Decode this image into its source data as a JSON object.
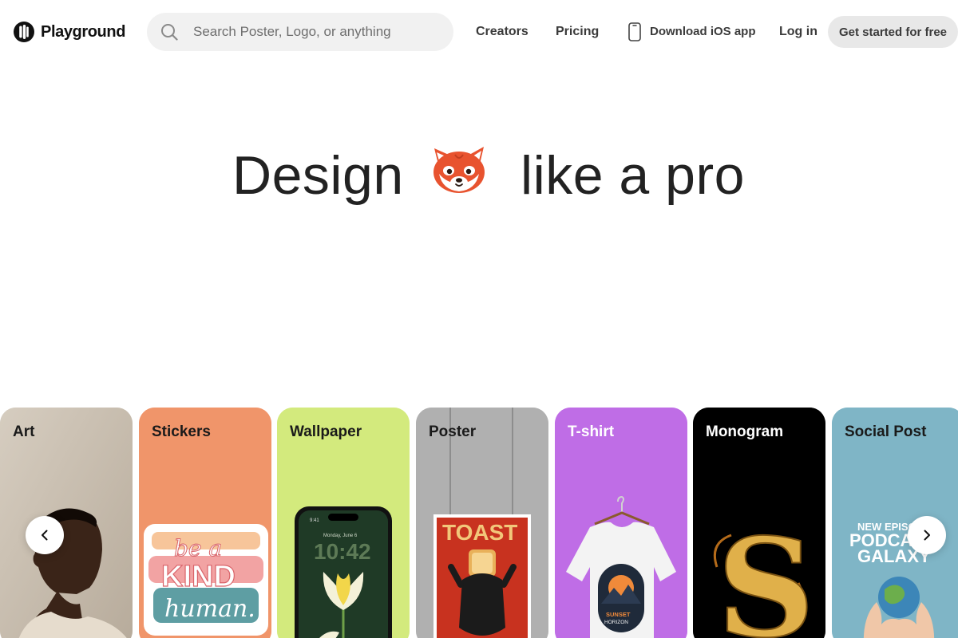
{
  "brand": {
    "name": "Playground"
  },
  "search": {
    "placeholder": "Search Poster, Logo, or anything",
    "value": ""
  },
  "nav": {
    "creators": "Creators",
    "pricing": "Pricing",
    "ios": "Download iOS app",
    "login": "Log in",
    "cta": "Get started for free"
  },
  "hero": {
    "left": "Design",
    "right": "like a pro"
  },
  "categories": [
    {
      "label": "Art",
      "bg": "#c9bfb1",
      "label_color": "#1a1a1a"
    },
    {
      "label": "Stickers",
      "bg": "#f0956a",
      "label_color": "#1a1a1a",
      "art_text": [
        "be a",
        "KIND",
        "human."
      ]
    },
    {
      "label": "Wallpaper",
      "bg": "#d3ea7d",
      "label_color": "#1a1a1a",
      "art_text": [
        "9:41",
        "Monday, June 6",
        "10:42"
      ]
    },
    {
      "label": "Poster",
      "bg": "#b0b0b0",
      "label_color": "#1a1a1a",
      "art_text": [
        "TOAST"
      ]
    },
    {
      "label": "T-shirt",
      "bg": "#bf6de6",
      "label_color": "#ffffff",
      "art_text": [
        "SUNSET",
        "HORIZON"
      ]
    },
    {
      "label": "Monogram",
      "bg": "#000000",
      "label_color": "#ffffff",
      "art_text": [
        "S"
      ]
    },
    {
      "label": "Social Post",
      "bg": "#7fb5c6",
      "label_color": "#1a1a1a",
      "art_text": [
        "NEW EPISODE",
        "PODCAST",
        "GALAXY"
      ]
    }
  ],
  "icons": {
    "search": "search-icon",
    "phone": "phone-icon",
    "prev": "chevron-left-icon",
    "next": "chevron-right-icon",
    "mascot": "red-panda-icon"
  }
}
